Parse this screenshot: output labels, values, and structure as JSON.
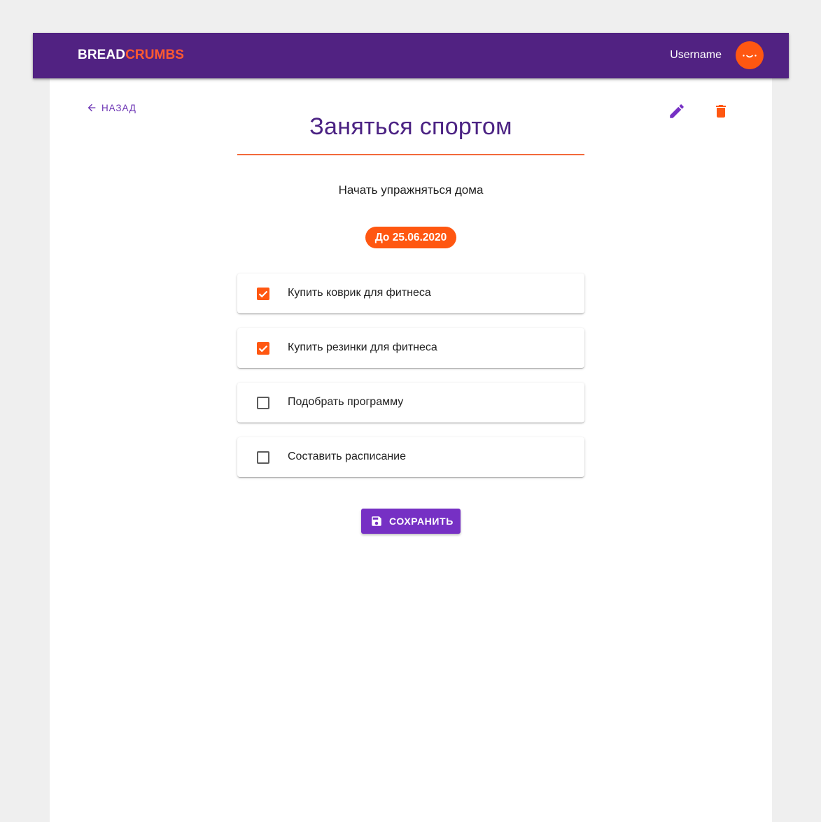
{
  "header": {
    "logo_part1": "BREAD",
    "logo_part2": "CRUMBS",
    "username": "Username",
    "avatar_icon": "smiley-avatar-icon"
  },
  "toolbar": {
    "back_label": "НАЗАД",
    "back_icon": "arrow-left-icon",
    "edit_icon": "pencil-icon",
    "delete_icon": "trash-icon"
  },
  "goal": {
    "title": "Заняться спортом",
    "description": "Начать упражняться дома",
    "deadline": "До 25.06.2020"
  },
  "tasks": [
    {
      "label": "Купить коврик для фитнеса",
      "checked": true
    },
    {
      "label": "Купить резинки для фитнеса",
      "checked": true
    },
    {
      "label": "Подобрать программу",
      "checked": false
    },
    {
      "label": "Составить расписание",
      "checked": false
    }
  ],
  "save_button": {
    "label": "СОХРАНИТЬ",
    "icon": "floppy-disk-icon"
  },
  "colors": {
    "primary": "#512282",
    "accent": "#ff5711",
    "button": "#7630c4",
    "title": "#4b2283"
  }
}
